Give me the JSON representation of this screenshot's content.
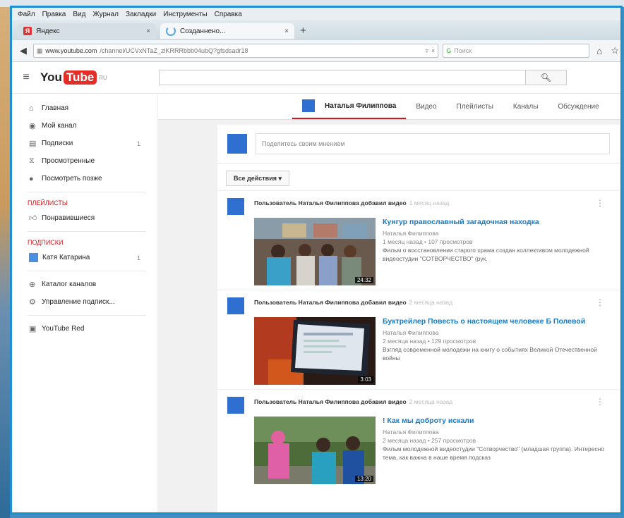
{
  "browser": {
    "menu": [
      "Файл",
      "Правка",
      "Вид",
      "Журнал",
      "Закладки",
      "Инструменты",
      "Справка"
    ],
    "tabs": [
      {
        "label": "Яндекс",
        "close": "×"
      },
      {
        "label": "Созданнено...",
        "close": "×"
      }
    ],
    "new_tab": "+",
    "url_host": "www.youtube.com",
    "url_path": "/channel/UCVxNTaZ_zlKRRRbbb04ubQ?gfsdsadr18",
    "search_placeholder": "Поиск"
  },
  "youtube": {
    "logo_you": "You",
    "logo_tube": "Tube",
    "logo_region": "RU",
    "search_icon": "search-icon"
  },
  "sidebar": {
    "items": [
      {
        "label": "Главная",
        "icon": "home-icon"
      },
      {
        "label": "Мой канал",
        "icon": "user-icon"
      },
      {
        "label": "Подписки",
        "icon": "subscriptions-icon",
        "count": "1"
      },
      {
        "label": "Просмотренные",
        "icon": "history-icon"
      },
      {
        "label": "Посмотреть позже",
        "icon": "clock-icon"
      }
    ],
    "playlists_title": "ПЛЕЙЛИСТЫ",
    "playlists": [
      {
        "label": "Понравившиеся",
        "icon": "thumbs-up-icon"
      }
    ],
    "subs_title": "ПОДПИСКИ",
    "subs": [
      {
        "label": "Катя Катарина",
        "count": "1"
      }
    ],
    "extra": [
      {
        "label": "Каталог каналов",
        "icon": "plus-circle-icon"
      },
      {
        "label": "Управление подписк...",
        "icon": "gear-icon"
      }
    ],
    "red": {
      "label": "YouTube Red",
      "icon": "youtube-red-icon"
    }
  },
  "channel": {
    "name": "Наталья Филиппова",
    "tabs": [
      "Видео",
      "Плейлисты",
      "Каналы",
      "Обсуждение"
    ]
  },
  "feed": {
    "share_placeholder": "Поделитесь своим мнением",
    "filter_label": "Все действия ▾",
    "posts": [
      {
        "action": "Пользователь Наталья Филиппова добавил видео",
        "time": "1 месяц назад",
        "title": "Кунгур православный загадочная находка",
        "author": "Наталья Филиппова",
        "stats": "1 месяц назад • 107 просмотров",
        "desc": "Фильм о восстановлении старого храма создан коллективом молодежной видеостудии \"СОТВОРЧЕСТВО\" (рук.",
        "duration": "24:32"
      },
      {
        "action": "Пользователь Наталья Филиппова добавил видео",
        "time": "2 месяца назад",
        "title": "Буктрейлер Повесть о настоящем человеке Б Полевой",
        "author": "Наталья Филиппова",
        "stats": "2 месяца назад • 129 просмотров",
        "desc": "Взгляд современной молодежи на книгу о событиях Великой Отечественной войны",
        "duration": "3:03"
      },
      {
        "action": "Пользователь Наталья Филиппова добавил видео",
        "time": "2 месяца назад",
        "title": "! Как мы доброту искали",
        "author": "Наталья Филиппова",
        "stats": "2 месяца назад • 257 просмотров",
        "desc": "Фильм молодежной видеостудии \"Сотворчество\" (младшая группа). Интересно тема, как важна в наше время подсказ",
        "duration": "13:20"
      }
    ]
  },
  "colors": {
    "accent": "#cc181e",
    "link": "#167ac6",
    "avatar": "#2f6fd0",
    "frame": "#1e8fd0"
  }
}
